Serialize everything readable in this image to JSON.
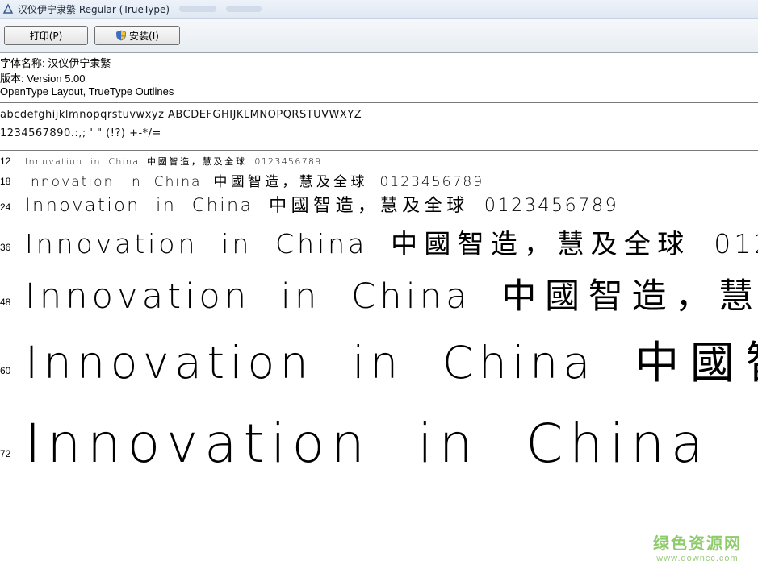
{
  "window": {
    "title": "汉仪伊宁隶繁 Regular (TrueType)",
    "app_icon": "font-viewer-icon"
  },
  "toolbar": {
    "print_label": "打印(P)",
    "install_label": "安装(I)",
    "install_icon": "shield-icon"
  },
  "info": {
    "font_name": "字体名称: 汉仪伊宁隶繁",
    "version": "版本: Version 5.00",
    "type": "OpenType Layout, TrueType Outlines"
  },
  "charset": {
    "line1": "abcdefghijklmnopqrstuvwxyz  ABCDEFGHIJKLMNOPQRSTUVWXYZ",
    "line2": "1234567890.:,;  '  \"  (!?)  +-*/="
  },
  "samples": {
    "latin": "Innovation  in  China  ",
    "cjk": "中國智造，慧及全球",
    "digits": "  0123456789",
    "rows": [
      {
        "size": "12"
      },
      {
        "size": "18"
      },
      {
        "size": "24"
      },
      {
        "size": "36"
      },
      {
        "size": "48"
      },
      {
        "size": "60"
      },
      {
        "size": "72"
      }
    ]
  },
  "watermark": {
    "text": "绿色资源网",
    "url": "www.downcc.com"
  }
}
